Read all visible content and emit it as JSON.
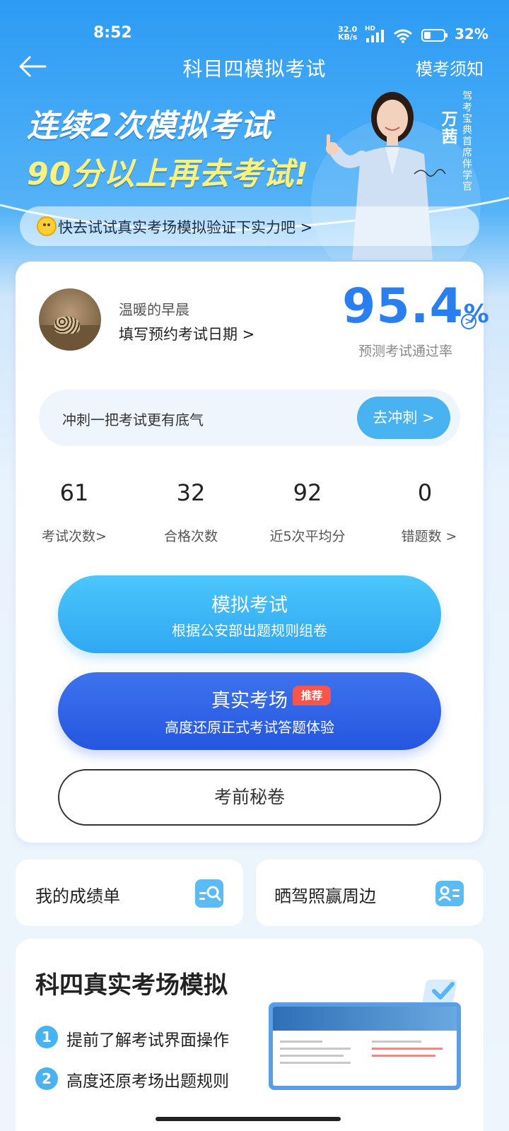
{
  "status_bar": {
    "time": "8:52",
    "net_speed_value": "32.0",
    "net_speed_unit": "KB/s",
    "hd": "HD",
    "battery": "32%"
  },
  "nav": {
    "title": "科目四模拟考试",
    "right_link": "模考须知"
  },
  "banner": {
    "line1": "连续2次模拟考试",
    "line2": "90分以上再去考试!",
    "tip": "快去试试真实考场模拟验证下实力吧 >",
    "presenter_name": "万茜",
    "presenter_role": "驾考宝典首席伴学官"
  },
  "profile": {
    "name": "温暖的早晨",
    "exam_date_link": "填写预约考试日期 >",
    "pass_rate_value": "95.4",
    "pass_rate_unit": "%",
    "pass_rate_info": ">",
    "pass_rate_label": "预测考试通过率"
  },
  "sprint": {
    "text": "冲刺一把考试更有底气",
    "button": "去冲刺 >"
  },
  "stats": [
    {
      "value": "61",
      "label": "考试次数>"
    },
    {
      "value": "32",
      "label": "合格次数"
    },
    {
      "value": "92",
      "label": "近5次平均分"
    },
    {
      "value": "0",
      "label": "错题数 >"
    }
  ],
  "actions": {
    "mock_title": "模拟考试",
    "mock_sub": "根据公安部出题规则组卷",
    "real_title": "真实考场",
    "real_badge": "推荐",
    "real_sub": "高度还原正式考试答题体验",
    "secret": "考前秘卷"
  },
  "cards": {
    "report": "我的成绩单",
    "share": "晒驾照赢周边"
  },
  "simulation": {
    "title": "科四真实考场模拟",
    "features": [
      {
        "num": "1",
        "text": "提前了解考试界面操作"
      },
      {
        "num": "2",
        "text": "高度还原考场出题规则"
      }
    ]
  },
  "colors": {
    "primary_blue": "#2a7ff0",
    "light_blue_button": "#49b3f2",
    "dark_blue_button": "#2556e0",
    "badge_red": "#f8564a"
  }
}
